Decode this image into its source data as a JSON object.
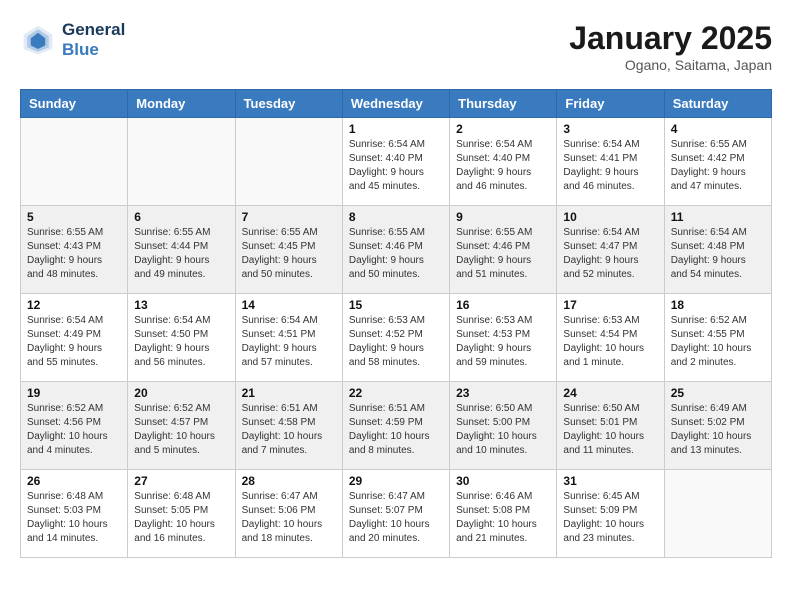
{
  "header": {
    "logo_line1": "General",
    "logo_line2": "Blue",
    "month": "January 2025",
    "location": "Ogano, Saitama, Japan"
  },
  "days_of_week": [
    "Sunday",
    "Monday",
    "Tuesday",
    "Wednesday",
    "Thursday",
    "Friday",
    "Saturday"
  ],
  "weeks": [
    [
      {
        "num": "",
        "info": ""
      },
      {
        "num": "",
        "info": ""
      },
      {
        "num": "",
        "info": ""
      },
      {
        "num": "1",
        "info": "Sunrise: 6:54 AM\nSunset: 4:40 PM\nDaylight: 9 hours\nand 45 minutes."
      },
      {
        "num": "2",
        "info": "Sunrise: 6:54 AM\nSunset: 4:40 PM\nDaylight: 9 hours\nand 46 minutes."
      },
      {
        "num": "3",
        "info": "Sunrise: 6:54 AM\nSunset: 4:41 PM\nDaylight: 9 hours\nand 46 minutes."
      },
      {
        "num": "4",
        "info": "Sunrise: 6:55 AM\nSunset: 4:42 PM\nDaylight: 9 hours\nand 47 minutes."
      }
    ],
    [
      {
        "num": "5",
        "info": "Sunrise: 6:55 AM\nSunset: 4:43 PM\nDaylight: 9 hours\nand 48 minutes."
      },
      {
        "num": "6",
        "info": "Sunrise: 6:55 AM\nSunset: 4:44 PM\nDaylight: 9 hours\nand 49 minutes."
      },
      {
        "num": "7",
        "info": "Sunrise: 6:55 AM\nSunset: 4:45 PM\nDaylight: 9 hours\nand 50 minutes."
      },
      {
        "num": "8",
        "info": "Sunrise: 6:55 AM\nSunset: 4:46 PM\nDaylight: 9 hours\nand 50 minutes."
      },
      {
        "num": "9",
        "info": "Sunrise: 6:55 AM\nSunset: 4:46 PM\nDaylight: 9 hours\nand 51 minutes."
      },
      {
        "num": "10",
        "info": "Sunrise: 6:54 AM\nSunset: 4:47 PM\nDaylight: 9 hours\nand 52 minutes."
      },
      {
        "num": "11",
        "info": "Sunrise: 6:54 AM\nSunset: 4:48 PM\nDaylight: 9 hours\nand 54 minutes."
      }
    ],
    [
      {
        "num": "12",
        "info": "Sunrise: 6:54 AM\nSunset: 4:49 PM\nDaylight: 9 hours\nand 55 minutes."
      },
      {
        "num": "13",
        "info": "Sunrise: 6:54 AM\nSunset: 4:50 PM\nDaylight: 9 hours\nand 56 minutes."
      },
      {
        "num": "14",
        "info": "Sunrise: 6:54 AM\nSunset: 4:51 PM\nDaylight: 9 hours\nand 57 minutes."
      },
      {
        "num": "15",
        "info": "Sunrise: 6:53 AM\nSunset: 4:52 PM\nDaylight: 9 hours\nand 58 minutes."
      },
      {
        "num": "16",
        "info": "Sunrise: 6:53 AM\nSunset: 4:53 PM\nDaylight: 9 hours\nand 59 minutes."
      },
      {
        "num": "17",
        "info": "Sunrise: 6:53 AM\nSunset: 4:54 PM\nDaylight: 10 hours\nand 1 minute."
      },
      {
        "num": "18",
        "info": "Sunrise: 6:52 AM\nSunset: 4:55 PM\nDaylight: 10 hours\nand 2 minutes."
      }
    ],
    [
      {
        "num": "19",
        "info": "Sunrise: 6:52 AM\nSunset: 4:56 PM\nDaylight: 10 hours\nand 4 minutes."
      },
      {
        "num": "20",
        "info": "Sunrise: 6:52 AM\nSunset: 4:57 PM\nDaylight: 10 hours\nand 5 minutes."
      },
      {
        "num": "21",
        "info": "Sunrise: 6:51 AM\nSunset: 4:58 PM\nDaylight: 10 hours\nand 7 minutes."
      },
      {
        "num": "22",
        "info": "Sunrise: 6:51 AM\nSunset: 4:59 PM\nDaylight: 10 hours\nand 8 minutes."
      },
      {
        "num": "23",
        "info": "Sunrise: 6:50 AM\nSunset: 5:00 PM\nDaylight: 10 hours\nand 10 minutes."
      },
      {
        "num": "24",
        "info": "Sunrise: 6:50 AM\nSunset: 5:01 PM\nDaylight: 10 hours\nand 11 minutes."
      },
      {
        "num": "25",
        "info": "Sunrise: 6:49 AM\nSunset: 5:02 PM\nDaylight: 10 hours\nand 13 minutes."
      }
    ],
    [
      {
        "num": "26",
        "info": "Sunrise: 6:48 AM\nSunset: 5:03 PM\nDaylight: 10 hours\nand 14 minutes."
      },
      {
        "num": "27",
        "info": "Sunrise: 6:48 AM\nSunset: 5:05 PM\nDaylight: 10 hours\nand 16 minutes."
      },
      {
        "num": "28",
        "info": "Sunrise: 6:47 AM\nSunset: 5:06 PM\nDaylight: 10 hours\nand 18 minutes."
      },
      {
        "num": "29",
        "info": "Sunrise: 6:47 AM\nSunset: 5:07 PM\nDaylight: 10 hours\nand 20 minutes."
      },
      {
        "num": "30",
        "info": "Sunrise: 6:46 AM\nSunset: 5:08 PM\nDaylight: 10 hours\nand 21 minutes."
      },
      {
        "num": "31",
        "info": "Sunrise: 6:45 AM\nSunset: 5:09 PM\nDaylight: 10 hours\nand 23 minutes."
      },
      {
        "num": "",
        "info": ""
      }
    ]
  ]
}
